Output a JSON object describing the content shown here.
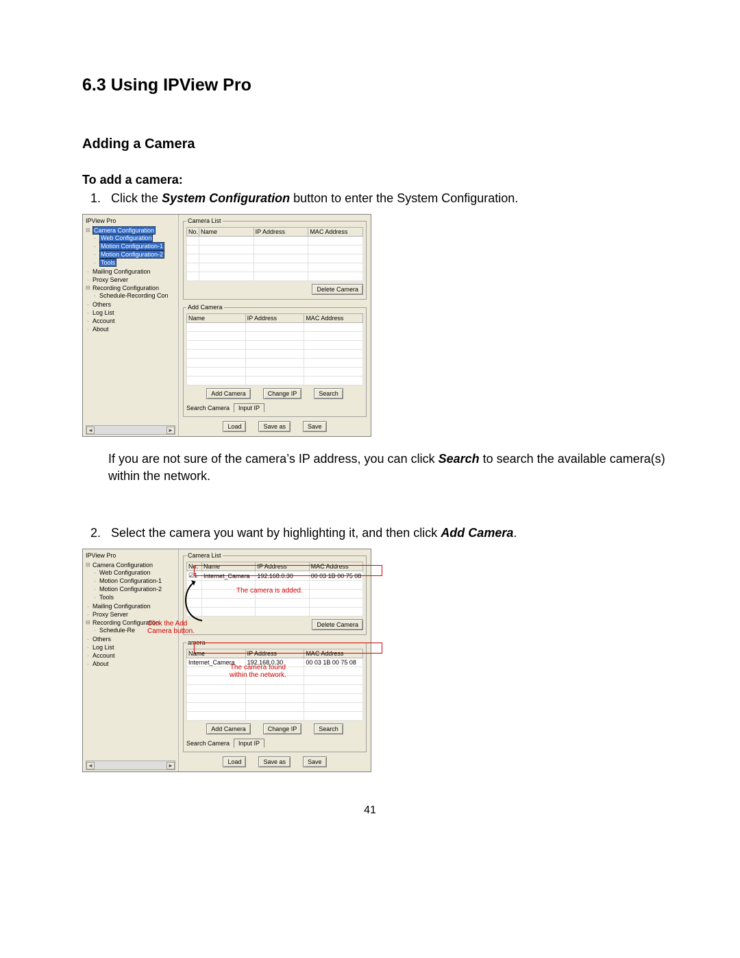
{
  "headings": {
    "section": "6.3 Using IPView Pro",
    "subsection": "Adding a Camera",
    "label_to_add": "To add a camera:"
  },
  "steps": {
    "step1_number": "1.",
    "step1_prefix": "Click the ",
    "step1_bolditalic": "System Configuration",
    "step1_suffix": " button to enter the System Configuration.",
    "step2_number": "2.",
    "step2_prefix": "Select the camera you want by highlighting it, and then click ",
    "step2_bolditalic": "Add Camera",
    "step2_suffix": "."
  },
  "paragraph_between": {
    "prefix": "If you are not sure of the camera’s IP address, you can click ",
    "bolditalic": "Search",
    "suffix": " to search the available camera(s) within the network."
  },
  "window_title": "IPView Pro",
  "tree": {
    "root": "Camera Configuration",
    "children_level1": [
      "Web Configuration",
      "Motion Configuration-1",
      "Motion Configuration-2",
      "Tools"
    ],
    "siblings": [
      "Mailing Configuration",
      "Proxy Server"
    ],
    "recording": "Recording Configuration",
    "recording_child1_a": "Schedule-Recording Con",
    "recording_child1_b": "Schedule-Re",
    "tail": [
      "Others",
      "Log List",
      "Account",
      "About"
    ]
  },
  "dialog_a": {
    "camera_list_legend": "Camera List",
    "cols_list": {
      "no": "No.",
      "name": "Name",
      "ip": "IP Address",
      "mac": "MAC Address"
    },
    "delete_btn": "Delete Camera",
    "add_camera_legend": "Add Camera",
    "cols_add": {
      "name": "Name",
      "ip": "IP Address",
      "mac": "MAC Address"
    },
    "add_btn": "Add Camera",
    "change_btn": "Change IP",
    "search_btn": "Search",
    "search_camera_label": "Search Camera",
    "input_ip_tab": "Input IP",
    "load_btn": "Load",
    "saveas_btn": "Save as",
    "save_btn": "Save"
  },
  "dialog_b": {
    "camera_list_legend": "Camera List",
    "cols_list": {
      "no": "No.",
      "name": "Name",
      "ip": "IP Address",
      "mac": "MAC Address"
    },
    "row_list": {
      "no": "1",
      "name": "Internet_Camera",
      "ip": "192.168.0.30",
      "mac": "00 03 1B 00 75 08"
    },
    "delete_btn": "Delete Camera",
    "add_camera_legend_suffix": "amera",
    "cols_add": {
      "name": "Name",
      "ip": "IP Address",
      "mac": "MAC Address"
    },
    "row_add": {
      "name": "Internet_Camera",
      "ip": "192.168.0.30",
      "mac": "00 03 1B 00 75 08"
    },
    "add_btn": "Add Camera",
    "change_btn": "Change IP",
    "search_btn": "Search",
    "search_camera_label": "Search Camera",
    "input_ip_tab": "Input IP",
    "load_btn": "Load",
    "saveas_btn": "Save as",
    "save_btn": "Save"
  },
  "annotations": {
    "camera_added": "The camera is added.",
    "click_add_line1": "Click the Add",
    "click_add_line2": "Camera button.",
    "camera_found_line1": "The camera found",
    "camera_found_line2": "within the network."
  },
  "check_glyph": "☑",
  "page_number": "41"
}
